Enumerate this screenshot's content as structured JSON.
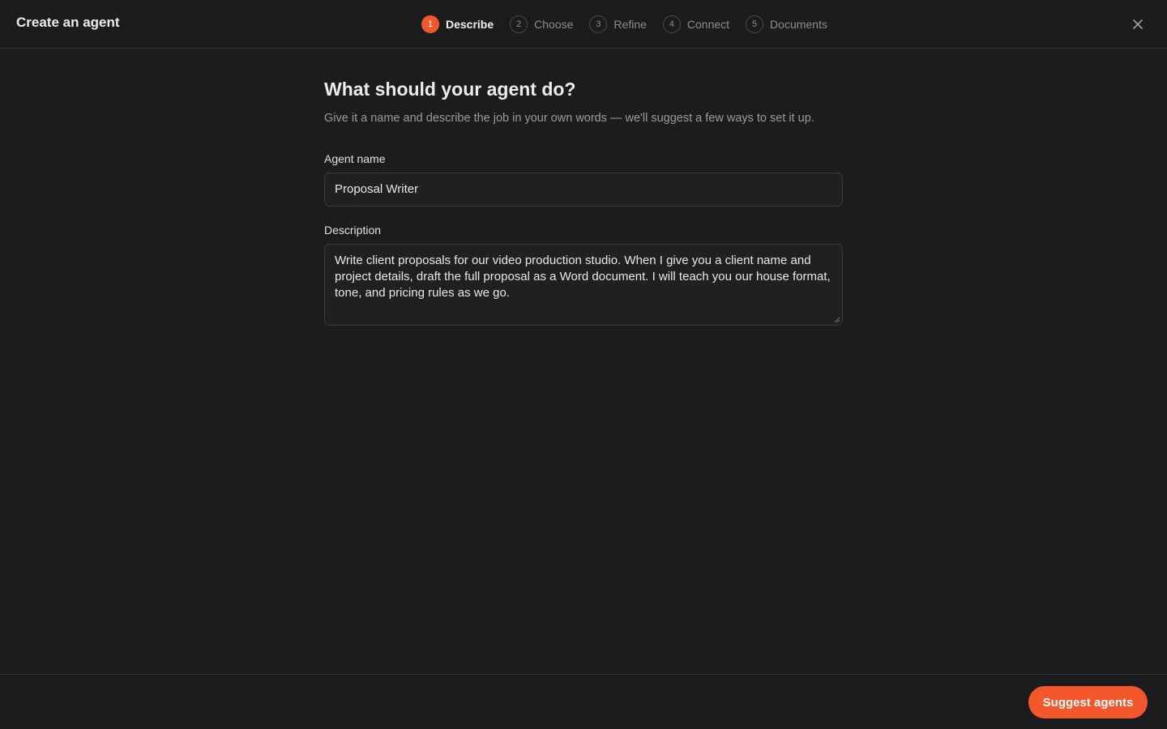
{
  "header": {
    "title": "Create an agent",
    "close_icon": "close-icon"
  },
  "stepper": {
    "active_index": 0,
    "accent_color": "#f4572a",
    "steps": [
      {
        "number": "1",
        "label": "Describe"
      },
      {
        "number": "2",
        "label": "Choose"
      },
      {
        "number": "3",
        "label": "Refine"
      },
      {
        "number": "4",
        "label": "Connect"
      },
      {
        "number": "5",
        "label": "Documents"
      }
    ]
  },
  "main": {
    "title": "What should your agent do?",
    "subtitle": "Give it a name and describe the job in your own words — we'll suggest a few ways to set it up.",
    "name_label": "Agent name",
    "name_value": "Proposal Writer",
    "description_label": "Description",
    "description_value": "Write client proposals for our video production studio. When I give you a client name and project details, draft the full proposal as a Word document. I will teach you our house format, tone, and pricing rules as we go."
  },
  "footer": {
    "primary_button": "Suggest agents"
  }
}
